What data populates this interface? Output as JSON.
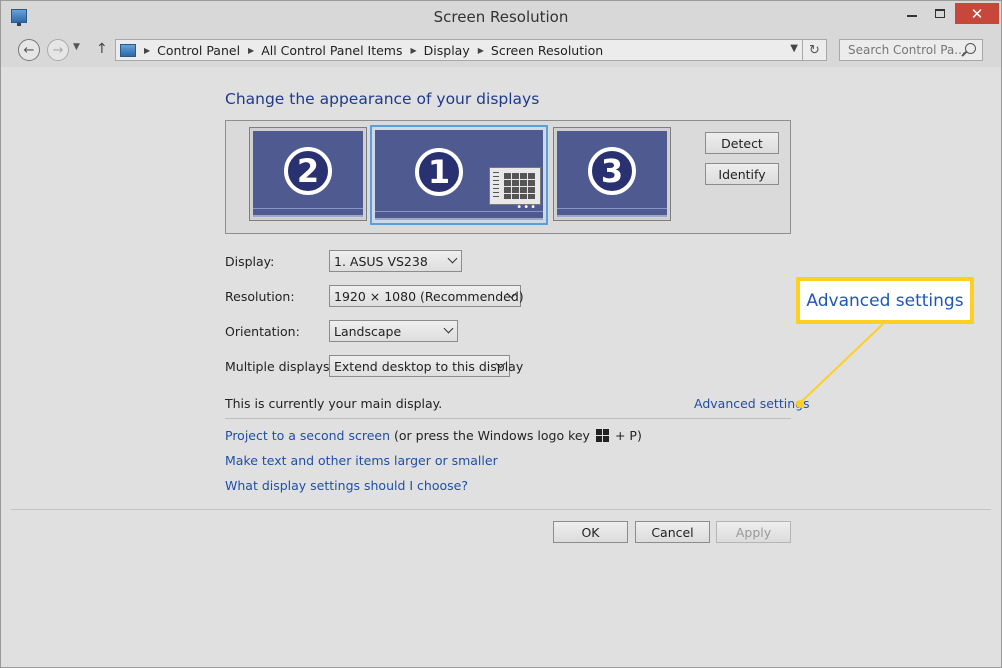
{
  "window": {
    "title": "Screen Resolution",
    "close_glyph": "✕"
  },
  "address_bar": {
    "breadcrumbs": [
      "Control Panel",
      "All Control Panel Items",
      "Display",
      "Screen Resolution"
    ],
    "search_placeholder": "Search Control Pa..."
  },
  "main": {
    "heading": "Change the appearance of your displays",
    "monitors": [
      {
        "number": "2",
        "selected": false
      },
      {
        "number": "1",
        "selected": true
      },
      {
        "number": "3",
        "selected": false
      }
    ],
    "detect_label": "Detect",
    "identify_label": "Identify",
    "fields": {
      "display": {
        "label": "Display:",
        "value": "1. ASUS VS238"
      },
      "resolution": {
        "label": "Resolution:",
        "value": "1920 × 1080 (Recommended)"
      },
      "orientation": {
        "label": "Orientation:",
        "value": "Landscape"
      },
      "multiple": {
        "label": "Multiple displays:",
        "value": "Extend desktop to this display"
      }
    },
    "main_display_text": "This is currently your main display.",
    "advanced_settings_link": "Advanced settings",
    "project_link": "Project to a second screen",
    "project_suffix_before": "(or press the Windows logo key",
    "project_suffix_after": "+ P)",
    "text_size_link": "Make text and other items larger or smaller",
    "help_link": "What display settings should I choose?"
  },
  "buttons": {
    "ok": "OK",
    "cancel": "Cancel",
    "apply": "Apply"
  },
  "callout": {
    "text": "Advanced settings",
    "color": "#ffcf22"
  }
}
